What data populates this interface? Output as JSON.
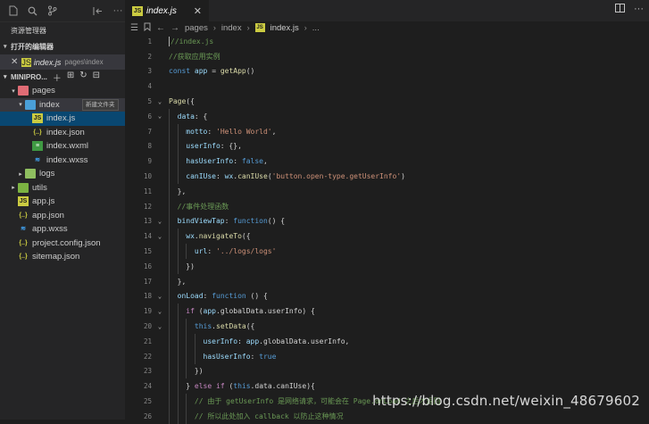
{
  "sidebar": {
    "title": "资源管理器",
    "open_editors_label": "打开的编辑器",
    "open_editor": {
      "name": "index.js",
      "path": "pages\\index"
    },
    "project_label": "MINIPRO...",
    "tooltip": "新建文件夹",
    "tree": [
      {
        "label": "pages",
        "icon": "folder-pages-icon"
      },
      {
        "label": "index",
        "icon": "folder-index-icon"
      },
      {
        "label": "index.js",
        "icon": "js-file-icon"
      },
      {
        "label": "index.json",
        "icon": "json-file-icon"
      },
      {
        "label": "index.wxml",
        "icon": "wxml-file-icon"
      },
      {
        "label": "index.wxss",
        "icon": "wxss-file-icon"
      },
      {
        "label": "logs",
        "icon": "folder-logs-icon"
      },
      {
        "label": "utils",
        "icon": "folder-utils-icon"
      },
      {
        "label": "app.js",
        "icon": "js-file-icon"
      },
      {
        "label": "app.json",
        "icon": "json-file-icon"
      },
      {
        "label": "app.wxss",
        "icon": "wxss-file-icon"
      },
      {
        "label": "project.config.json",
        "icon": "json-file-icon"
      },
      {
        "label": "sitemap.json",
        "icon": "json-file-icon"
      }
    ]
  },
  "editor": {
    "tab_label": "index.js",
    "breadcrumb": [
      "pages",
      "index",
      "index.js",
      "..."
    ]
  },
  "code_lines": [
    "//index.js",
    "//获取应用实例",
    "const app = getApp()",
    "",
    "Page({",
    "  data: {",
    "    motto: 'Hello World',",
    "    userInfo: {},",
    "    hasUserInfo: false,",
    "    canIUse: wx.canIUse('button.open-type.getUserInfo')",
    "  },",
    "  //事件处理函数",
    "  bindViewTap: function() {",
    "    wx.navigateTo({",
    "      url: '../logs/logs'",
    "    })",
    "  },",
    "  onLoad: function () {",
    "    if (app.globalData.userInfo) {",
    "      this.setData({",
    "        userInfo: app.globalData.userInfo,",
    "        hasUserInfo: true",
    "      })",
    "    } else if (this.data.canIUse){",
    "      // 由于 getUserInfo 是网络请求，可能会在 Page.onLoad 之后才返回",
    "      // 所以此处加入 callback 以防止这种情况"
  ],
  "watermark": "https://blog.csdn.net/weixin_48679602"
}
